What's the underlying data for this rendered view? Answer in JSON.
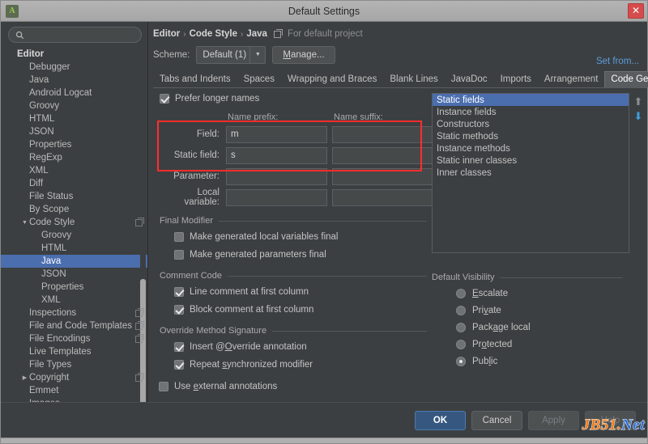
{
  "window": {
    "title": "Default Settings",
    "close_label": "✕",
    "app_icon": "android-studio-icon"
  },
  "sidebar": {
    "search_placeholder": "",
    "search_value": "",
    "items": [
      {
        "label": "Editor",
        "indent": 0,
        "bold": true,
        "arrow": "",
        "selected": false,
        "copyable": false
      },
      {
        "label": "Debugger",
        "indent": 1,
        "bold": false,
        "arrow": "",
        "selected": false,
        "copyable": false
      },
      {
        "label": "Java",
        "indent": 1,
        "bold": false,
        "arrow": "",
        "selected": false,
        "copyable": false
      },
      {
        "label": "Android Logcat",
        "indent": 1,
        "bold": false,
        "arrow": "",
        "selected": false,
        "copyable": false
      },
      {
        "label": "Groovy",
        "indent": 1,
        "bold": false,
        "arrow": "",
        "selected": false,
        "copyable": false
      },
      {
        "label": "HTML",
        "indent": 1,
        "bold": false,
        "arrow": "",
        "selected": false,
        "copyable": false
      },
      {
        "label": "JSON",
        "indent": 1,
        "bold": false,
        "arrow": "",
        "selected": false,
        "copyable": false
      },
      {
        "label": "Properties",
        "indent": 1,
        "bold": false,
        "arrow": "",
        "selected": false,
        "copyable": false
      },
      {
        "label": "RegExp",
        "indent": 1,
        "bold": false,
        "arrow": "",
        "selected": false,
        "copyable": false
      },
      {
        "label": "XML",
        "indent": 1,
        "bold": false,
        "arrow": "",
        "selected": false,
        "copyable": false
      },
      {
        "label": "Diff",
        "indent": 1,
        "bold": false,
        "arrow": "",
        "selected": false,
        "copyable": false
      },
      {
        "label": "File Status",
        "indent": 1,
        "bold": false,
        "arrow": "",
        "selected": false,
        "copyable": false
      },
      {
        "label": "By Scope",
        "indent": 1,
        "bold": false,
        "arrow": "",
        "selected": false,
        "copyable": false
      },
      {
        "label": "Code Style",
        "indent": 1,
        "bold": false,
        "arrow": "▼",
        "selected": false,
        "copyable": true
      },
      {
        "label": "Groovy",
        "indent": 2,
        "bold": false,
        "arrow": "",
        "selected": false,
        "copyable": false
      },
      {
        "label": "HTML",
        "indent": 2,
        "bold": false,
        "arrow": "",
        "selected": false,
        "copyable": false
      },
      {
        "label": "Java",
        "indent": 2,
        "bold": false,
        "arrow": "",
        "selected": true,
        "copyable": false
      },
      {
        "label": "JSON",
        "indent": 2,
        "bold": false,
        "arrow": "",
        "selected": false,
        "copyable": false
      },
      {
        "label": "Properties",
        "indent": 2,
        "bold": false,
        "arrow": "",
        "selected": false,
        "copyable": false
      },
      {
        "label": "XML",
        "indent": 2,
        "bold": false,
        "arrow": "",
        "selected": false,
        "copyable": false
      },
      {
        "label": "Inspections",
        "indent": 1,
        "bold": false,
        "arrow": "",
        "selected": false,
        "copyable": true
      },
      {
        "label": "File and Code Templates",
        "indent": 1,
        "bold": false,
        "arrow": "",
        "selected": false,
        "copyable": true
      },
      {
        "label": "File Encodings",
        "indent": 1,
        "bold": false,
        "arrow": "",
        "selected": false,
        "copyable": true
      },
      {
        "label": "Live Templates",
        "indent": 1,
        "bold": false,
        "arrow": "",
        "selected": false,
        "copyable": false
      },
      {
        "label": "File Types",
        "indent": 1,
        "bold": false,
        "arrow": "",
        "selected": false,
        "copyable": false
      },
      {
        "label": "Copyright",
        "indent": 1,
        "bold": false,
        "arrow": "▶",
        "selected": false,
        "copyable": true
      },
      {
        "label": "Emmet",
        "indent": 1,
        "bold": false,
        "arrow": "",
        "selected": false,
        "copyable": false
      },
      {
        "label": "Images",
        "indent": 1,
        "bold": false,
        "arrow": "",
        "selected": false,
        "copyable": false
      }
    ]
  },
  "breadcrumb": {
    "parts": [
      "Editor",
      "Code Style",
      "Java"
    ],
    "separator": "›",
    "note": "For default project"
  },
  "scheme": {
    "label": "Scheme:",
    "value": "Default (1)",
    "arrow": "▼",
    "manage_prefix": "",
    "manage_mnemonic": "M",
    "manage_suffix": "anage...",
    "set_from": "Set from..."
  },
  "tabs": [
    {
      "label": "Tabs and Indents",
      "active": false
    },
    {
      "label": "Spaces",
      "active": false
    },
    {
      "label": "Wrapping and Braces",
      "active": false
    },
    {
      "label": "Blank Lines",
      "active": false
    },
    {
      "label": "JavaDoc",
      "active": false
    },
    {
      "label": "Imports",
      "active": false
    },
    {
      "label": "Arrangement",
      "active": false
    },
    {
      "label": "Code Generation",
      "active": true
    }
  ],
  "naming": {
    "prefer_longer_names": {
      "label": "Prefer longer names",
      "checked": true
    },
    "col_prefix": "Name prefix:",
    "col_suffix": "Name suffix:",
    "rows": [
      {
        "label": "Field:",
        "prefix": "m",
        "suffix": ""
      },
      {
        "label": "Static field:",
        "prefix": "s",
        "suffix": ""
      },
      {
        "label": "Parameter:",
        "prefix": "",
        "suffix": ""
      },
      {
        "label": "Local variable:",
        "prefix": "",
        "suffix": ""
      }
    ],
    "highlight_color": "#ff2d2d"
  },
  "final_modifier": {
    "title": "Final Modifier",
    "options": [
      {
        "label": "Make generated local variables final",
        "checked": false
      },
      {
        "label": "Make generated parameters final",
        "checked": false
      }
    ]
  },
  "comment_code": {
    "title": "Comment Code",
    "options": [
      {
        "label": "Line comment at first column",
        "checked": true
      },
      {
        "label": "Block comment at first column",
        "checked": true
      }
    ]
  },
  "override_signature": {
    "title": "Override Method Signature",
    "options": [
      {
        "pre": "Insert @",
        "mnemonic": "O",
        "post": "verride annotation",
        "checked": true
      },
      {
        "pre": "Repeat ",
        "mnemonic": "s",
        "post": "ynchronized modifier",
        "checked": true
      }
    ]
  },
  "external_annotations": {
    "pre": "Use ",
    "mnemonic": "e",
    "post": "xternal annotations",
    "checked": false
  },
  "members_order": {
    "items": [
      {
        "label": "Static fields",
        "selected": true
      },
      {
        "label": "Instance fields",
        "selected": false
      },
      {
        "label": "Constructors",
        "selected": false
      },
      {
        "label": "Static methods",
        "selected": false
      },
      {
        "label": "Instance methods",
        "selected": false
      },
      {
        "label": "Static inner classes",
        "selected": false
      },
      {
        "label": "Inner classes",
        "selected": false
      }
    ],
    "move_up_icon": "arrow-up-icon",
    "move_down_icon": "arrow-down-icon",
    "move_up_glyph": "⬆",
    "move_down_glyph": "⬇"
  },
  "default_visibility": {
    "title": "Default Visibility",
    "options": [
      {
        "pre": "",
        "mnemonic": "E",
        "post": "scalate",
        "selected": false
      },
      {
        "pre": "Pri",
        "mnemonic": "v",
        "post": "ate",
        "selected": false
      },
      {
        "pre": "Pack",
        "mnemonic": "a",
        "post": "ge local",
        "selected": false
      },
      {
        "pre": "Pr",
        "mnemonic": "o",
        "post": "tected",
        "selected": false
      },
      {
        "pre": "Pub",
        "mnemonic": "l",
        "post": "ic",
        "selected": true
      }
    ]
  },
  "footer": {
    "ok": "OK",
    "cancel": "Cancel",
    "apply": "Apply",
    "help": "Help",
    "watermark_a": "JB51.",
    "watermark_b": "Net"
  }
}
